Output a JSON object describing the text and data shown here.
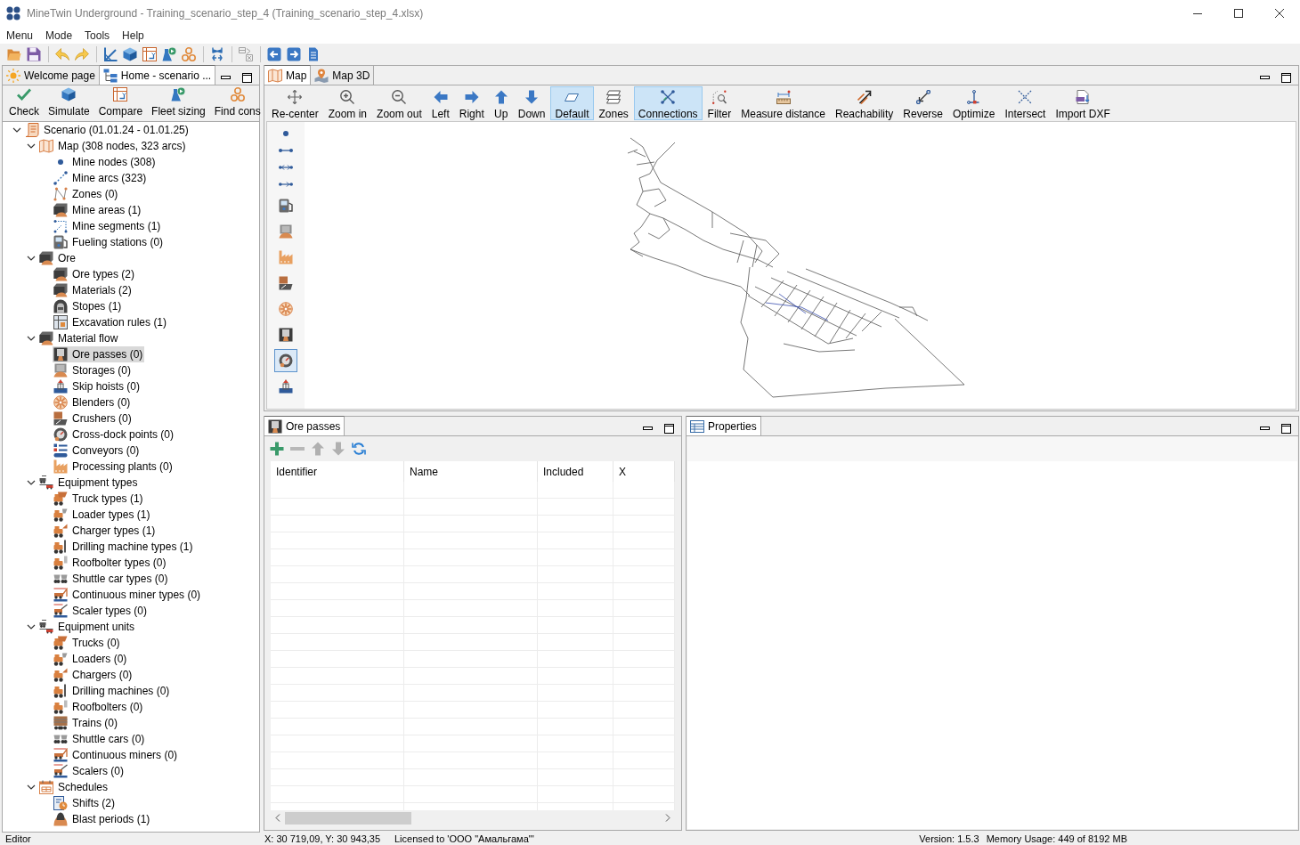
{
  "window": {
    "title": "MineTwin Underground - Training_scenario_step_4 (Training_scenario_step_4.xlsx)"
  },
  "menu": [
    {
      "label": "Menu"
    },
    {
      "label": "Mode"
    },
    {
      "label": "Tools"
    },
    {
      "label": "Help"
    }
  ],
  "toolbar": {
    "groups": [
      {
        "buttons": [
          {
            "kind": "open",
            "disabled": false
          },
          {
            "kind": "save",
            "disabled": false
          }
        ]
      },
      {
        "buttons": [
          {
            "kind": "undo",
            "disabled": false
          },
          {
            "kind": "redo",
            "disabled": false
          }
        ]
      },
      {
        "buttons": [
          {
            "kind": "draft",
            "disabled": false
          },
          {
            "kind": "cube",
            "disabled": false
          },
          {
            "kind": "compare",
            "disabled": false
          },
          {
            "kind": "fleet",
            "disabled": false
          },
          {
            "kind": "find",
            "disabled": false
          }
        ]
      },
      {
        "buttons": [
          {
            "kind": "connect",
            "disabled": false
          }
        ]
      },
      {
        "buttons": [
          {
            "kind": "calc",
            "disabled": true
          }
        ]
      },
      {
        "buttons": [
          {
            "kind": "back",
            "disabled": false
          },
          {
            "kind": "forward",
            "disabled": false
          },
          {
            "kind": "document",
            "disabled": false
          }
        ]
      }
    ]
  },
  "left_panel": {
    "tabs": [
      {
        "label": "Welcome page",
        "kind": "sun",
        "selected": false
      },
      {
        "label": "Home - scenario ...",
        "kind": "tree",
        "selected": true
      }
    ],
    "actions": [
      {
        "label": "Check",
        "kind": "check"
      },
      {
        "label": "Simulate",
        "kind": "cube"
      },
      {
        "label": "Compare",
        "kind": "compare"
      },
      {
        "label": "Fleet sizing",
        "kind": "fleet"
      },
      {
        "label": "Find cons",
        "kind": "find"
      }
    ],
    "tree": [
      {
        "label": "Scenario (01.01.24 - 01.01.25)",
        "kind": "scroll",
        "expanded": true,
        "selected": false,
        "children": [
          {
            "label": "Map (308 nodes, 323 arcs)",
            "kind": "map",
            "expanded": true,
            "selected": false,
            "children": [
              {
                "label": "Mine nodes (308)",
                "kind": "dot",
                "selected": false
              },
              {
                "label": "Mine arcs (323)",
                "kind": "arc",
                "selected": false
              },
              {
                "label": "Zones (0)",
                "kind": "zone",
                "selected": false
              },
              {
                "label": "Mine areas (1)",
                "kind": "block",
                "selected": false
              },
              {
                "label": "Mine segments (1)",
                "kind": "segment",
                "selected": false
              },
              {
                "label": "Fueling stations (0)",
                "kind": "station",
                "selected": false
              }
            ]
          },
          {
            "label": "Ore",
            "kind": "block",
            "expanded": true,
            "selected": false,
            "children": [
              {
                "label": "Ore types (2)",
                "kind": "block",
                "selected": false
              },
              {
                "label": "Materials (2)",
                "kind": "block",
                "selected": false
              },
              {
                "label": "Stopes (1)",
                "kind": "stope",
                "selected": false
              },
              {
                "label": "Excavation rules (1)",
                "kind": "rules",
                "selected": false
              }
            ]
          },
          {
            "label": "Material flow",
            "kind": "block",
            "expanded": true,
            "selected": false,
            "children": [
              {
                "label": "Ore passes (0)",
                "kind": "orepass",
                "selected": true
              },
              {
                "label": "Storages (0)",
                "kind": "storage",
                "selected": false
              },
              {
                "label": "Skip hoists (0)",
                "kind": "hoist",
                "selected": false
              },
              {
                "label": "Blenders (0)",
                "kind": "blender",
                "selected": false
              },
              {
                "label": "Crushers (0)",
                "kind": "crusher",
                "selected": false
              },
              {
                "label": "Cross-dock points (0)",
                "kind": "crossdock",
                "selected": false
              },
              {
                "label": "Conveyors (0)",
                "kind": "conveyor",
                "selected": false
              },
              {
                "label": "Processing plants (0)",
                "kind": "plant",
                "selected": false
              }
            ]
          },
          {
            "label": "Equipment types",
            "kind": "equipment",
            "expanded": true,
            "selected": false,
            "children": [
              {
                "label": "Truck types (1)",
                "kind": "truck",
                "selected": false
              },
              {
                "label": "Loader types (1)",
                "kind": "loader",
                "selected": false
              },
              {
                "label": "Charger types (1)",
                "kind": "charger",
                "selected": false
              },
              {
                "label": "Drilling machine types (1)",
                "kind": "drill",
                "selected": false
              },
              {
                "label": "Roofbolter types (0)",
                "kind": "bolter",
                "selected": false
              },
              {
                "label": "Shuttle car types (0)",
                "kind": "shuttle",
                "selected": false
              },
              {
                "label": "Continuous miner types (0)",
                "kind": "miner",
                "selected": false
              },
              {
                "label": "Scaler types (0)",
                "kind": "scaler",
                "selected": false
              }
            ]
          },
          {
            "label": "Equipment units",
            "kind": "equipment",
            "expanded": true,
            "selected": false,
            "children": [
              {
                "label": "Trucks (0)",
                "kind": "truck",
                "selected": false
              },
              {
                "label": "Loaders (0)",
                "kind": "loader",
                "selected": false
              },
              {
                "label": "Chargers (0)",
                "kind": "charger",
                "selected": false
              },
              {
                "label": "Drilling machines (0)",
                "kind": "drill",
                "selected": false
              },
              {
                "label": "Roofbolters (0)",
                "kind": "bolter",
                "selected": false
              },
              {
                "label": "Trains (0)",
                "kind": "train",
                "selected": false
              },
              {
                "label": "Shuttle cars (0)",
                "kind": "shuttle",
                "selected": false
              },
              {
                "label": "Continuous miners (0)",
                "kind": "miner",
                "selected": false
              },
              {
                "label": "Scalers (0)",
                "kind": "scaler",
                "selected": false
              }
            ]
          },
          {
            "label": "Schedules",
            "kind": "calendar",
            "expanded": true,
            "selected": false,
            "children": [
              {
                "label": "Shifts (2)",
                "kind": "shifts",
                "selected": false
              },
              {
                "label": "Blast periods (1)",
                "kind": "blast",
                "selected": false
              }
            ]
          }
        ]
      }
    ]
  },
  "map_panel": {
    "tabs": [
      {
        "label": "Map",
        "kind": "map",
        "selected": true
      },
      {
        "label": "Map 3D",
        "kind": "pin",
        "selected": false
      }
    ],
    "tools": [
      {
        "label": "Re-center",
        "kind": "recenter",
        "selected": false
      },
      {
        "label": "Zoom in",
        "kind": "zoom-in",
        "selected": false
      },
      {
        "label": "Zoom out",
        "kind": "zoom-out",
        "selected": false
      },
      {
        "label": "Left",
        "kind": "left",
        "selected": false
      },
      {
        "label": "Right",
        "kind": "right",
        "selected": false
      },
      {
        "label": "Up",
        "kind": "up",
        "selected": false
      },
      {
        "label": "Down",
        "kind": "down",
        "selected": false
      },
      {
        "label": "Default",
        "kind": "default",
        "selected": true
      },
      {
        "label": "Zones",
        "kind": "zones",
        "selected": false
      },
      {
        "label": "Connections",
        "kind": "connections",
        "selected": true
      },
      {
        "label": "Filter",
        "kind": "filter",
        "selected": false
      },
      {
        "label": "Measure distance",
        "kind": "measure",
        "selected": false
      },
      {
        "label": "Reachability",
        "kind": "reachability",
        "selected": false
      },
      {
        "label": "Reverse",
        "kind": "reverse",
        "selected": false
      },
      {
        "label": "Optimize",
        "kind": "optimize",
        "selected": false
      },
      {
        "label": "Intersect",
        "kind": "intersect",
        "selected": false
      },
      {
        "label": "Import DXF",
        "kind": "import-dxf",
        "selected": false
      }
    ],
    "palette": [
      {
        "kind": "dot",
        "selected": false
      },
      {
        "kind": "line",
        "selected": false
      },
      {
        "kind": "two-way",
        "selected": false
      },
      {
        "kind": "one-way",
        "selected": false
      },
      {
        "kind": "station",
        "selected": false
      },
      {
        "kind": "storage",
        "selected": false
      },
      {
        "kind": "plant",
        "selected": false
      },
      {
        "kind": "crusher",
        "selected": false
      },
      {
        "kind": "blender",
        "selected": false
      },
      {
        "kind": "orepass",
        "selected": false
      },
      {
        "kind": "crossdock",
        "selected": true
      },
      {
        "kind": "hoist",
        "selected": false
      }
    ]
  },
  "ore_passes_panel": {
    "tab": {
      "label": "Ore passes",
      "kind": "orepass"
    },
    "actions": [
      {
        "kind": "add",
        "disabled": false
      },
      {
        "kind": "remove",
        "disabled": true
      },
      {
        "kind": "up",
        "disabled": true
      },
      {
        "kind": "down",
        "disabled": true
      },
      {
        "kind": "refresh",
        "disabled": false
      }
    ],
    "table": {
      "columns": [
        "Identifier",
        "Name",
        "Included",
        "X"
      ]
    }
  },
  "properties_panel": {
    "tab": {
      "label": "Properties",
      "kind": "table"
    }
  },
  "status_bar": {
    "mode": "Editor",
    "coordinates": "X: 30 719,09, Y: 30 943,35",
    "license": "Licensed to 'OOO \"Амальгама\"'",
    "version": "Version: 1.5.3",
    "memory": "Memory Usage: 449 of 8192 MB"
  }
}
